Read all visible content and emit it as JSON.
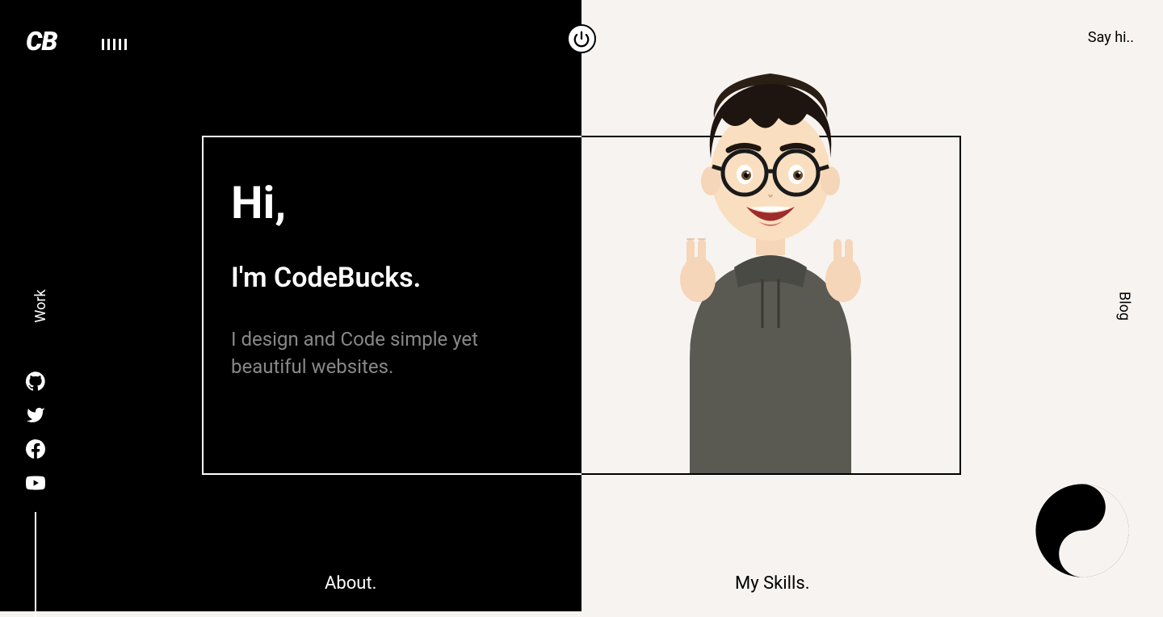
{
  "logo": "CB",
  "nav": {
    "say_hi": "Say hi..",
    "work": "Work",
    "blog": "Blog",
    "about": "About.",
    "skills": "My Skills."
  },
  "intro": {
    "greeting": "Hi,",
    "name_line": "I'm CodeBucks.",
    "description": "I design and Code simple yet beautiful websites."
  },
  "socials": {
    "github": "github-icon",
    "twitter": "twitter-icon",
    "facebook": "facebook-icon",
    "youtube": "youtube-icon"
  }
}
